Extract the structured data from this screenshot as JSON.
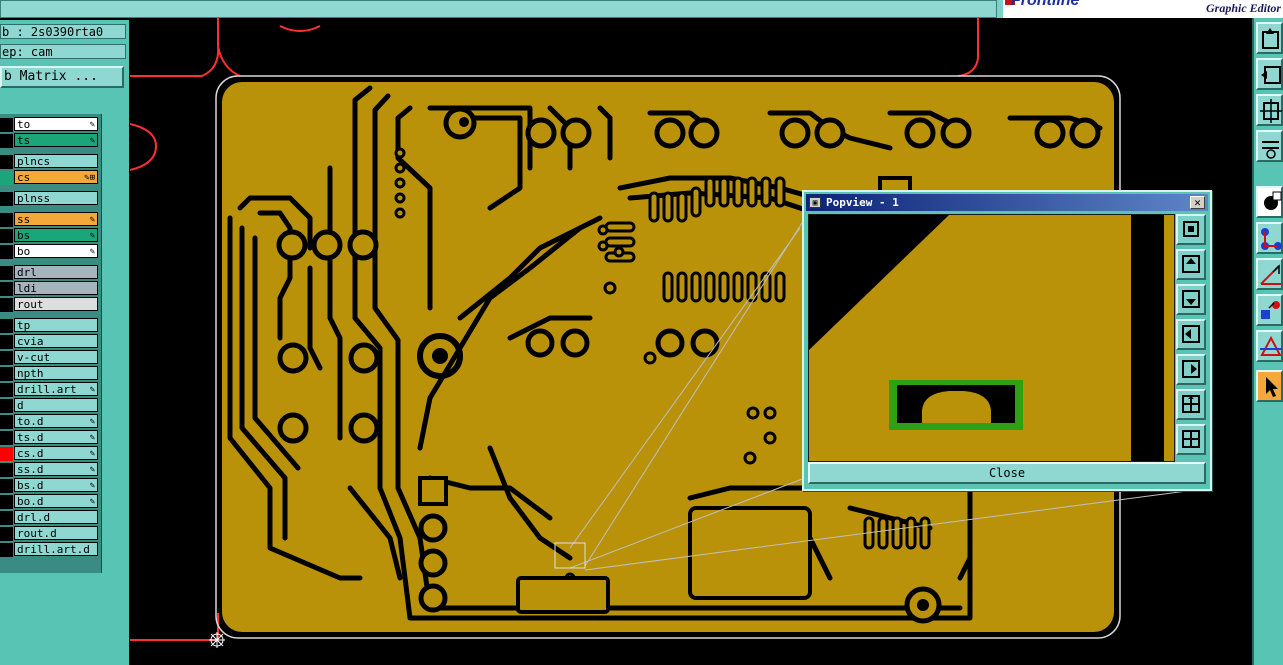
{
  "app": {
    "title_field": "",
    "brand_text": "Frontline",
    "brand_subtitle": "Graphic Editor"
  },
  "left_panel": {
    "job_text": "b : 2s0390rta0",
    "step_text": "ep: cam",
    "matrix_button": "b Matrix ...",
    "layers": [
      {
        "name": "to",
        "bg": "#ffffff",
        "icon": "✎",
        "marker": ""
      },
      {
        "name": "ts",
        "bg": "#1aa67a",
        "icon": "✎",
        "marker": ""
      },
      {
        "name": "plncs",
        "bg": "#8fd8d2",
        "icon": "",
        "marker": ""
      },
      {
        "name": "cs",
        "bg": "#f4a83a",
        "icon": "✎⊞",
        "marker": "#1aa67a"
      },
      {
        "name": "plnss",
        "bg": "#8fd8d2",
        "icon": "",
        "marker": ""
      },
      {
        "name": "ss",
        "bg": "#f4a83a",
        "icon": "✎",
        "marker": ""
      },
      {
        "name": "bs",
        "bg": "#1aa67a",
        "icon": "✎",
        "marker": ""
      },
      {
        "name": "bo",
        "bg": "#ffffff",
        "icon": "✎",
        "marker": ""
      },
      {
        "name": "drl",
        "bg": "#a6b4be",
        "icon": "",
        "marker": ""
      },
      {
        "name": "ldi",
        "bg": "#a6b4be",
        "icon": "",
        "marker": ""
      },
      {
        "name": "rout",
        "bg": "#dedede",
        "icon": "",
        "marker": ""
      },
      {
        "name": "tp",
        "bg": "#8fd8d2",
        "icon": "",
        "marker": ""
      },
      {
        "name": "cvia",
        "bg": "#8fd8d2",
        "icon": "",
        "marker": ""
      },
      {
        "name": "v-cut",
        "bg": "#8fd8d2",
        "icon": "",
        "marker": ""
      },
      {
        "name": "npth",
        "bg": "#8fd8d2",
        "icon": "",
        "marker": ""
      },
      {
        "name": "drill.art",
        "bg": "#8fd8d2",
        "icon": "✎",
        "marker": ""
      },
      {
        "name": "d",
        "bg": "#8fd8d2",
        "icon": "",
        "marker": ""
      },
      {
        "name": "to.d",
        "bg": "#8fd8d2",
        "icon": "✎",
        "marker": ""
      },
      {
        "name": "ts.d",
        "bg": "#8fd8d2",
        "icon": "✎",
        "marker": ""
      },
      {
        "name": "cs.d",
        "bg": "#8fd8d2",
        "icon": "✎",
        "marker": "#ff0000"
      },
      {
        "name": "ss.d",
        "bg": "#8fd8d2",
        "icon": "✎",
        "marker": ""
      },
      {
        "name": "bs.d",
        "bg": "#8fd8d2",
        "icon": "✎",
        "marker": ""
      },
      {
        "name": "bo.d",
        "bg": "#8fd8d2",
        "icon": "✎",
        "marker": ""
      },
      {
        "name": "drl.d",
        "bg": "#8fd8d2",
        "icon": "",
        "marker": ""
      },
      {
        "name": "rout.d",
        "bg": "#8fd8d2",
        "icon": "",
        "marker": ""
      },
      {
        "name": "drill.art.d",
        "bg": "#8fd8d2",
        "icon": "",
        "marker": ""
      }
    ]
  },
  "popup": {
    "title": "Popview - 1",
    "close_glyph": "✕",
    "close_button": "Close",
    "tool_icons": [
      "zoom-fit-icon",
      "pan-up-icon",
      "pan-down-icon",
      "pan-left-icon",
      "pan-right-icon",
      "zoom-in-icon",
      "zoom-out-icon"
    ]
  },
  "right_toolbar": {
    "icons": [
      "pan-up-icon",
      "pan-left-icon",
      "zoom-fit-icon",
      "snap-tool-icon",
      "select-feature-icon",
      "network-connect-icon",
      "measure-icon",
      "add-feature-icon",
      "drc-icon",
      "pointer-icon"
    ]
  },
  "colors": {
    "copper": "#b9920a",
    "outline": "#ff3030",
    "panel": "#58c4b4",
    "field": "#8fd8d2",
    "selected": "#f4a83a",
    "highlight_green": "#1aa67a",
    "popup_green": "#2fa012"
  }
}
